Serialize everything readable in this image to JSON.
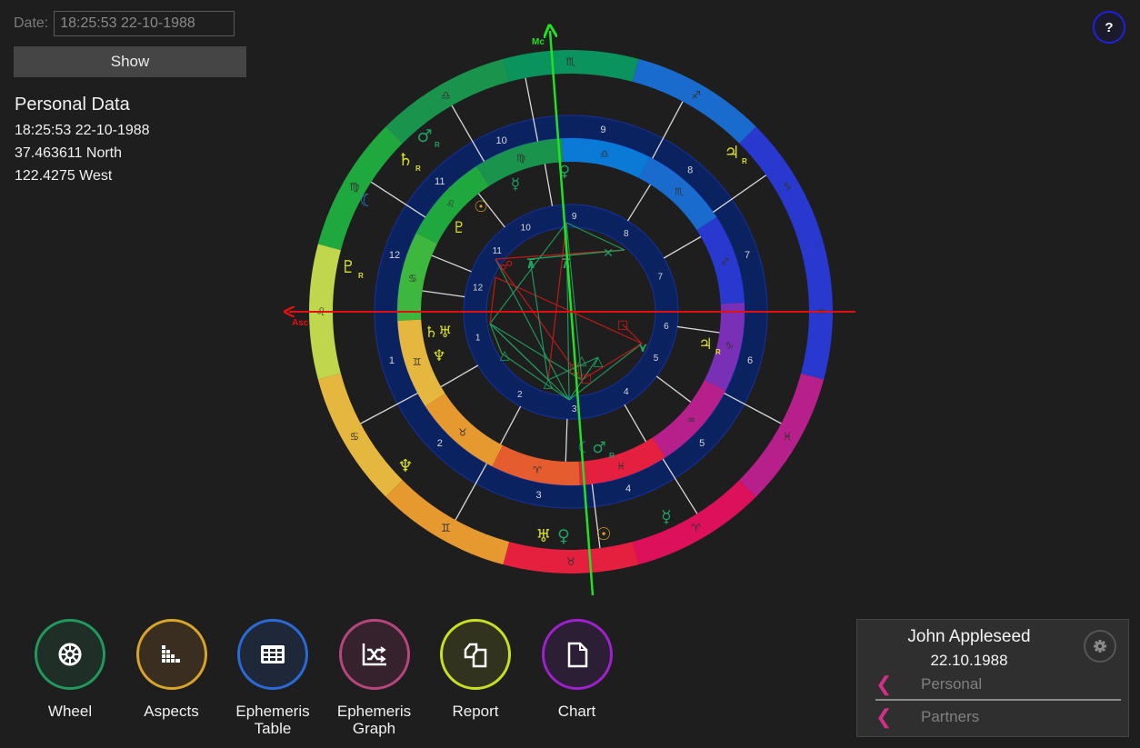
{
  "date_form": {
    "label": "Date:",
    "value": "18:25:53 22-10-1988",
    "show_label": "Show"
  },
  "personal_data": {
    "title": "Personal Data",
    "datetime": "18:25:53 22-10-1988",
    "latitude": "37.463611 North",
    "longitude": "122.4275 West"
  },
  "help": {
    "label": "?"
  },
  "wheel": {
    "axis_labels": {
      "mc": "Mc",
      "asc": "Asc"
    },
    "colors": {
      "mc": "#22e022",
      "asc": "#e01010",
      "house_ring": "#0a2260",
      "cusp": "#d8d8d8",
      "aspect_green": "#22a060",
      "aspect_red": "#d01818"
    },
    "outer_signs": [
      "♏",
      "♎",
      "♍",
      "♌",
      "♋",
      "♊",
      "♉",
      "♈",
      "♓",
      "♒",
      "♑",
      "♐"
    ],
    "outer_houses": [
      "10",
      "9",
      "8",
      "7",
      "6",
      "5",
      "4",
      "3",
      "2",
      "1",
      "12",
      "11"
    ],
    "middle_signs": [
      "♎",
      "♍",
      "♌",
      "♋",
      "♊",
      "♉",
      "♈",
      "♓",
      "♒",
      "♑",
      "♐",
      "♏"
    ],
    "inner_houses": [
      "9",
      "8",
      "7",
      "6",
      "5",
      "4",
      "3",
      "2",
      "1",
      "12",
      "11",
      "10"
    ],
    "outer_planets": [
      {
        "glyph": "♂",
        "retro": "R",
        "color": "#20a060",
        "ring": "outer"
      },
      {
        "glyph": "♄",
        "retro": "R",
        "color": "#d8e020",
        "ring": "outer"
      },
      {
        "glyph": "☾",
        "retro": "",
        "color": "#3080e0",
        "ring": "outer"
      },
      {
        "glyph": "♇",
        "retro": "R",
        "color": "#d8e020",
        "ring": "outer"
      },
      {
        "glyph": "♃",
        "retro": "R",
        "color": "#d8e020",
        "ring": "outer"
      },
      {
        "glyph": "♆",
        "retro": "",
        "color": "#d8e020",
        "ring": "outer"
      },
      {
        "glyph": "♅",
        "retro": "",
        "color": "#d8e020",
        "ring": "outer"
      },
      {
        "glyph": "♀",
        "retro": "",
        "color": "#20a060",
        "ring": "outer"
      },
      {
        "glyph": "☉",
        "retro": "",
        "color": "#e0a020",
        "ring": "outer"
      },
      {
        "glyph": "☿",
        "retro": "",
        "color": "#20a060",
        "ring": "outer"
      }
    ],
    "inner_planets": [
      {
        "glyph": "♀",
        "retro": "",
        "color": "#20a060"
      },
      {
        "glyph": "☿",
        "retro": "",
        "color": "#20a060"
      },
      {
        "glyph": "☉",
        "retro": "",
        "color": "#e0a020"
      },
      {
        "glyph": "♇",
        "retro": "",
        "color": "#d8e020"
      },
      {
        "glyph": "♄♅",
        "retro": "",
        "color": "#d8e020"
      },
      {
        "glyph": "♆",
        "retro": "",
        "color": "#d8e020"
      },
      {
        "glyph": "♃",
        "retro": "R",
        "color": "#d8e020"
      },
      {
        "glyph": "☾",
        "retro": "",
        "color": "#3080e0"
      },
      {
        "glyph": "♂",
        "retro": "R",
        "color": "#20a060"
      }
    ]
  },
  "nav": [
    {
      "label": "Wheel",
      "icon": "wheel-icon",
      "color": "#1f9a5c",
      "bg": "#1f2e27"
    },
    {
      "label": "Aspects",
      "icon": "aspects-icon",
      "color": "#d9a42a",
      "bg": "#3a2e20"
    },
    {
      "label": "Ephemeris Table",
      "icon": "table-icon",
      "color": "#2a6ad9",
      "bg": "#1f2838"
    },
    {
      "label": "Ephemeris Graph",
      "icon": "graph-icon",
      "color": "#b8457e",
      "bg": "#35222c"
    },
    {
      "label": "Report",
      "icon": "report-icon",
      "color": "#c8e020",
      "bg": "#31331f"
    },
    {
      "label": "Chart",
      "icon": "chart-icon",
      "color": "#a020d0",
      "bg": "#2c1f35"
    }
  ],
  "profile": {
    "name": "John Appleseed",
    "date": "22.10.1988",
    "items": [
      {
        "label": "Personal"
      },
      {
        "label": "Partners"
      }
    ]
  }
}
